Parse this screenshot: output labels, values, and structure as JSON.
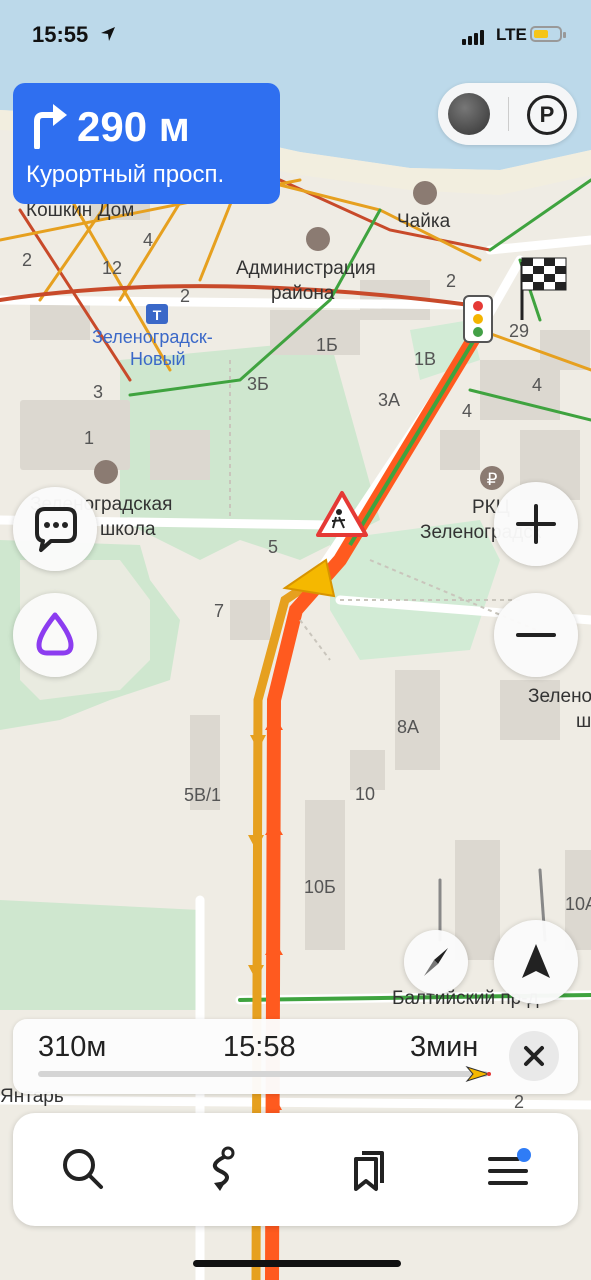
{
  "status_bar": {
    "time": "15:55",
    "network": "LTE"
  },
  "maneuver": {
    "distance": "290 м",
    "street": "Курортный просп."
  },
  "map": {
    "labels": {
      "koshkin_dom": "Кошкин Дом",
      "chaika": "Чайка",
      "administration": "Администрация",
      "rayona": "района",
      "station": "Зеленоградск-",
      "station2": "Новый",
      "school": "Зеленоградская",
      "school2": "школа",
      "rkc": "РКЦ",
      "rkc2": "Зеленоградск",
      "zelen_right": "Зелено",
      "zelen_right2": "ш",
      "baltic": "Балтийский пр-д",
      "yantar": "Янтарь",
      "n4a": "4",
      "n2a": "2",
      "n12": "12",
      "n2b": "2",
      "n2c": "2",
      "n29": "29",
      "n1b": "1Б",
      "n1v": "1В",
      "n3b": "3Б",
      "n3a": "3А",
      "n4b": "4",
      "n4c": "4",
      "n3": "3",
      "n1": "1",
      "n5": "5",
      "n7": "7",
      "n8a": "8А",
      "n10": "10",
      "n5v1": "5В/1",
      "n10b": "10Б",
      "n10a": "10А",
      "n2d": "2"
    }
  },
  "route_info": {
    "distance": "310м",
    "arrival": "15:58",
    "duration": "3мин"
  },
  "colors": {
    "maneuver_bg": "#2f6ff0",
    "route_main": "#ff5a1f",
    "traffic_green": "#3fa33f",
    "traffic_orange": "#e6a01f",
    "alice_purple": "#8c3cf0",
    "menu_badge": "#2f7cf6"
  },
  "icons": {
    "maneuver": "turn-right-arrow-icon",
    "traffic_layer": "traffic-layer-icon",
    "parking": "parking-icon",
    "chat": "chat-bubble-icon",
    "alice": "alice-voice-assistant-icon",
    "zoom_in": "plus-icon",
    "zoom_out": "minus-icon",
    "compass": "compass-icon",
    "locate": "navigation-arrow-icon",
    "close": "close-icon",
    "search": "search-icon",
    "route": "route-icon",
    "bookmarks": "bookmarks-icon",
    "menu": "menu-icon"
  }
}
